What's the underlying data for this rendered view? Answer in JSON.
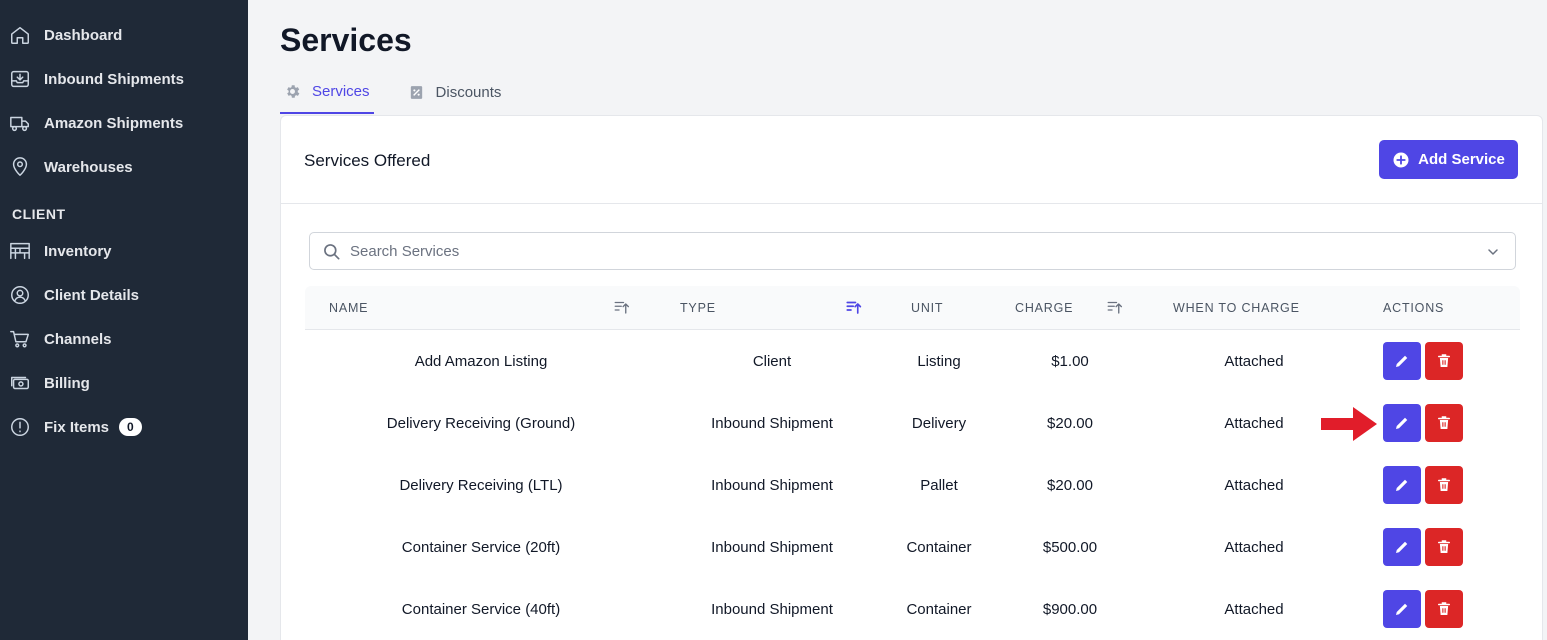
{
  "sidebar": {
    "items": [
      {
        "label": "Dashboard",
        "icon": "home-icon"
      },
      {
        "label": "Inbound Shipments",
        "icon": "inbox-download-icon"
      },
      {
        "label": "Amazon Shipments",
        "icon": "truck-icon"
      },
      {
        "label": "Warehouses",
        "icon": "map-pin-icon"
      }
    ],
    "section_label": "CLIENT",
    "client_items": [
      {
        "label": "Inventory",
        "icon": "warehouse-shelves-icon"
      },
      {
        "label": "Client Details",
        "icon": "user-circle-icon"
      },
      {
        "label": "Channels",
        "icon": "cart-icon"
      },
      {
        "label": "Billing",
        "icon": "cash-icon"
      },
      {
        "label": "Fix Items",
        "icon": "alert-circle-icon",
        "badge": "0"
      }
    ]
  },
  "page": {
    "title": "Services",
    "tabs": [
      {
        "label": "Services",
        "icon": "gear-icon",
        "active": true
      },
      {
        "label": "Discounts",
        "icon": "percent-receipt-icon",
        "active": false
      }
    ]
  },
  "card": {
    "title": "Services Offered",
    "add_button_label": "Add Service",
    "search_placeholder": "Search Services"
  },
  "table": {
    "columns": [
      "NAME",
      "TYPE",
      "UNIT",
      "CHARGE",
      "WHEN TO CHARGE",
      "ACTIONS"
    ],
    "active_sort_column": "TYPE",
    "rows": [
      {
        "name": "Add Amazon Listing",
        "type": "Client",
        "unit": "Listing",
        "charge": "$1.00",
        "when": "Attached"
      },
      {
        "name": "Delivery Receiving (Ground)",
        "type": "Inbound Shipment",
        "unit": "Delivery",
        "charge": "$20.00",
        "when": "Attached"
      },
      {
        "name": "Delivery Receiving (LTL)",
        "type": "Inbound Shipment",
        "unit": "Pallet",
        "charge": "$20.00",
        "when": "Attached"
      },
      {
        "name": "Container Service (20ft)",
        "type": "Inbound Shipment",
        "unit": "Container",
        "charge": "$500.00",
        "when": "Attached"
      },
      {
        "name": "Container Service (40ft)",
        "type": "Inbound Shipment",
        "unit": "Container",
        "charge": "$900.00",
        "when": "Attached"
      }
    ]
  },
  "colors": {
    "sidebar_bg": "#1f2937",
    "accent": "#4f46e5",
    "danger": "#dc2626",
    "annotation_arrow": "#e11d2a"
  },
  "annotation": {
    "icon": "red-arrow-icon",
    "points_to": "edit button on Delivery Receiving (Ground) row"
  }
}
